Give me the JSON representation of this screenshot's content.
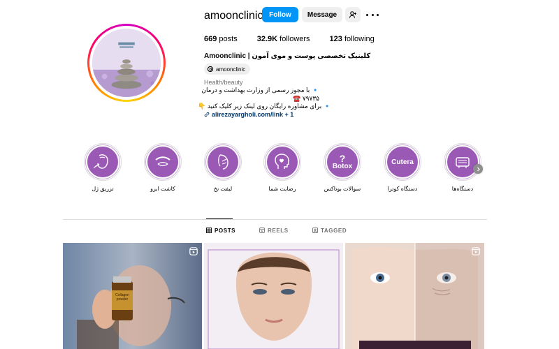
{
  "profile": {
    "username": "amoonclinic",
    "follow_label": "Follow",
    "message_label": "Message",
    "stats": {
      "posts_count": "669",
      "posts_label": "posts",
      "followers_count": "32.9K",
      "followers_label": "followers",
      "following_count": "123",
      "following_label": "following"
    },
    "display_name": "Amoonclinic |",
    "display_name_fa": "کلینیک تخصصی پوست و موی آمون",
    "threads_handle": "amoonclinic",
    "category": "Health/beauty",
    "bio_line1": "🔹 با مجوز رسمی از وزارت بهداشت و درمان",
    "bio_line2": "☎️ ۷۹۷۳۵",
    "bio_line3": "🔹 برای مشاوره رایگان روی لینک زیر کلیک کنید 👇",
    "link_text": "alirezayargholi.com/link + 1"
  },
  "highlights": [
    {
      "label": "تزریق ژل",
      "icon": "face-injection-icon"
    },
    {
      "label": "کاشت ابرو",
      "icon": "eyebrow-icon"
    },
    {
      "label": "لیفت نخ",
      "icon": "thread-lift-icon"
    },
    {
      "label": "رضایت شما",
      "icon": "head-heart-icon"
    },
    {
      "label": "سوالات بوتاکس",
      "icon": "botox-question-icon",
      "text": "Botox",
      "mark": "?"
    },
    {
      "label": "دستگاه کوترا",
      "icon": "cutera-icon",
      "text": "Cutera"
    },
    {
      "label": "دستگاه‌ها",
      "icon": "device-icon"
    }
  ],
  "tabs": [
    {
      "label": "POSTS",
      "icon": "grid-icon",
      "active": true
    },
    {
      "label": "REELS",
      "icon": "reels-icon",
      "active": false
    },
    {
      "label": "TAGGED",
      "icon": "tagged-icon",
      "active": false
    }
  ],
  "posts": [
    {
      "type": "reel",
      "icon": "reel-icon",
      "vial_label": "Collagen powder"
    },
    {
      "type": "image"
    },
    {
      "type": "reel",
      "icon": "reel-icon"
    }
  ],
  "colors": {
    "accent": "#0095f6",
    "highlight_purple": "#9b59b6",
    "link": "#00376b"
  }
}
